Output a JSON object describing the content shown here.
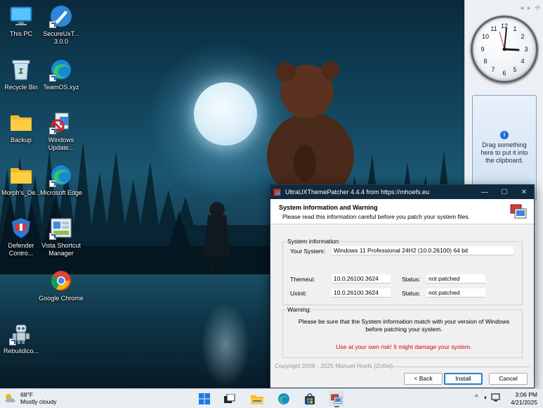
{
  "desktop": {
    "icons": [
      {
        "label": "This PC"
      },
      {
        "label": "SecureUxT... 3.0.0"
      },
      {
        "label": "Recycle Bin"
      },
      {
        "label": "TeamOS.xyz"
      },
      {
        "label": "Backup"
      },
      {
        "label": "Windows Update..."
      },
      {
        "label": "Morph's_De..."
      },
      {
        "label": "Microsoft Edge"
      },
      {
        "label": "Defender Contro..."
      },
      {
        "label": "Vista Shortcut Manager"
      },
      {
        "label": "Google Chrome"
      },
      {
        "label": "RebuildIco..."
      }
    ]
  },
  "gadgets": {
    "clock_numbers": [
      "12",
      "1",
      "2",
      "3",
      "4",
      "5",
      "6",
      "7",
      "8",
      "9",
      "10",
      "11"
    ],
    "clock_time": "3:06",
    "clipboard_text": "Drag something here to put it into the clipboard."
  },
  "window": {
    "title": "UltraUXThemePatcher 4.4.4 from https://mhoefs.eu",
    "header_title": "System information and Warning",
    "header_subtitle": "Please read this information careful before you patch your system files.",
    "sysinfo": {
      "legend": "System information:",
      "your_system_label": "Your System:",
      "your_system_value": "Windows 11 Professional 24H2 (10.0.26100) 64 bit",
      "themeui_label": "Themeui:",
      "themeui_value": "10.0.26100.3624",
      "themeui_status_label": "Status:",
      "themeui_status_value": "not patched",
      "uxinit_label": "Uxinit:",
      "uxinit_value": "10.0.26100.3624",
      "uxinit_status_label": "Status:",
      "uxinit_status_value": "not patched"
    },
    "warning": {
      "legend": "Warning:",
      "text": "Please be sure that the System information match with your version of Windows before patching your system.",
      "risk": "Use at your own risk! It might damage your system."
    },
    "copyright": "Copyright 2008 - 2025 Manuel Hoefs (Zottel)",
    "buttons": {
      "back": "< Back",
      "install": "Install",
      "cancel": "Cancel"
    }
  },
  "taskbar": {
    "weather_temp": "68°F",
    "weather_desc": "Mostly cloudy",
    "time": "3:06 PM",
    "date": "4/21/2025"
  },
  "colors": {
    "titlebar": "#0f2a3f",
    "risk_text": "#e00000",
    "accent": "#2b7cd3"
  }
}
